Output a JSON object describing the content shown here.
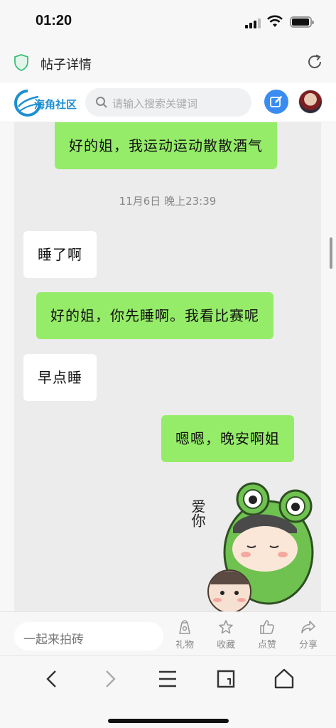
{
  "status": {
    "time": "01:20"
  },
  "browser": {
    "title": "帖子详情"
  },
  "site": {
    "logo_text": "海角社区",
    "search_placeholder": "请输入搜索关键词"
  },
  "chat": {
    "messages": [
      {
        "side": "me",
        "text": "好的姐，我运动运动散散酒气"
      },
      {
        "side": "them",
        "text": "睡了啊"
      },
      {
        "side": "me",
        "text": "好的姐，你先睡啊。我看比赛呢"
      },
      {
        "side": "them",
        "text": "早点睡"
      },
      {
        "side": "me",
        "text": "嗯嗯，晚安啊姐"
      }
    ],
    "timestamp": "11月6日 晚上23:39",
    "sticker_text": "爱你"
  },
  "actions": {
    "comment_placeholder": "一起来拍砖",
    "gift": "礼物",
    "favorite": "收藏",
    "like": "点赞",
    "share": "分享"
  },
  "colors": {
    "me_bubble": "#95ec69",
    "them_bubble": "#ffffff",
    "accent": "#3a8cf0"
  }
}
